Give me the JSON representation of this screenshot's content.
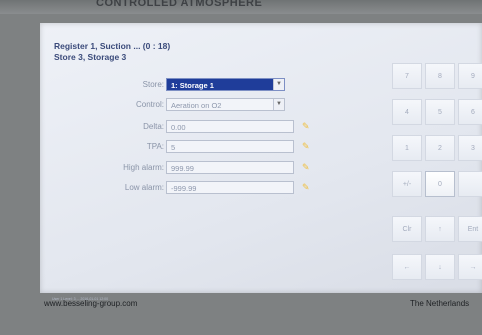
{
  "header": {
    "fragment": "CONTROLLED ATMOSPHERE"
  },
  "title": {
    "line1": "Register 1, Suction ... (0 : 18)",
    "line2": "Store 3, Storage 3"
  },
  "form": {
    "store": {
      "label": "Store:",
      "value": "1: Storage 1"
    },
    "control": {
      "label": "Control:",
      "value": "Aeration on O2"
    },
    "delta": {
      "label": "Delta:",
      "value": "0.00"
    },
    "tpa": {
      "label": "TPA:",
      "value": "5"
    },
    "high_alarm": {
      "label": "High alarm:",
      "value": "999.99"
    },
    "low_alarm": {
      "label": "Low alarm:",
      "value": "-999.99"
    }
  },
  "keypad": {
    "k7": "7",
    "k8": "8",
    "k9": "9",
    "k4": "4",
    "k5": "5",
    "k6": "6",
    "k1": "1",
    "k2": "2",
    "k3": "3",
    "sign": "+/-",
    "k0": "0",
    "clr": "Clr",
    "up": "↑",
    "ent": "Ent",
    "left": "←",
    "down": "↓",
    "right": "→"
  },
  "status": {
    "text": "User 1 Level: 3 ... 2016-01-01 12:00"
  },
  "footer": {
    "left": "www.besseling-group.com",
    "right": "The Netherlands"
  },
  "icons": {
    "edit": "pencil-icon",
    "dropdown": "chevron-down-icon"
  },
  "colors": {
    "selection": "#1f3d9a",
    "title": "#3a4a7a",
    "screen": "#e8ebf2",
    "bezel": "#7e8182"
  }
}
